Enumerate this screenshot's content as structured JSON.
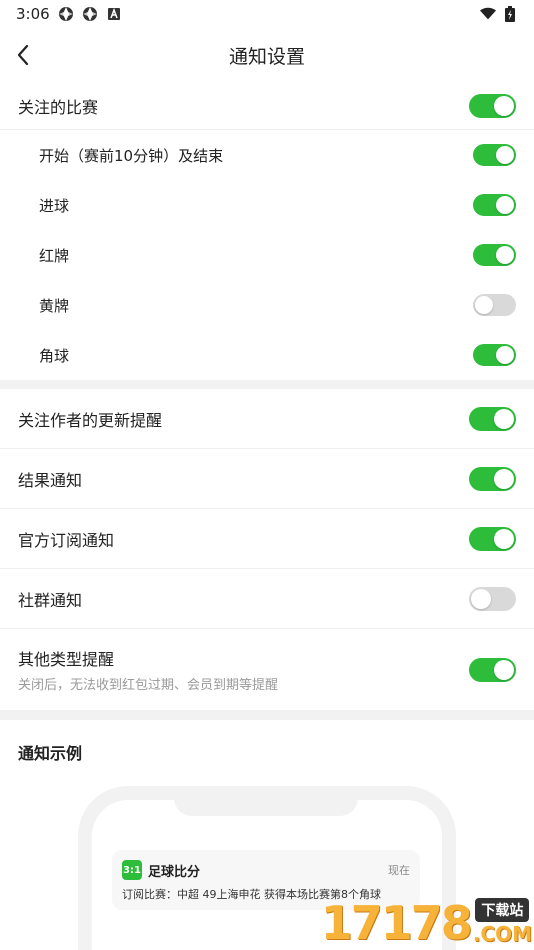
{
  "status_bar": {
    "time": "3:06",
    "left_icons": [
      "aperture-icon",
      "aperture-icon",
      "a-box-icon"
    ],
    "right_icons": [
      "wifi-icon",
      "battery-charging-icon"
    ]
  },
  "header": {
    "title": "通知设置"
  },
  "section1": {
    "main": {
      "label": "关注的比赛",
      "on": true
    },
    "items": [
      {
        "label": "开始（赛前10分钟）及结束",
        "on": true
      },
      {
        "label": "进球",
        "on": true
      },
      {
        "label": "红牌",
        "on": true
      },
      {
        "label": "黄牌",
        "on": false
      },
      {
        "label": "角球",
        "on": true
      }
    ]
  },
  "section2": {
    "items": [
      {
        "label": "关注作者的更新提醒",
        "on": true
      },
      {
        "label": "结果通知",
        "on": true
      },
      {
        "label": "官方订阅通知",
        "on": true
      },
      {
        "label": "社群通知",
        "on": false
      },
      {
        "label": "其他类型提醒",
        "desc": "关闭后，无法收到红包过期、会员到期等提醒",
        "on": true
      }
    ]
  },
  "example": {
    "title": "通知示例",
    "notification": {
      "app_logo_text": "3:1",
      "app_name": "足球比分",
      "time": "现在",
      "body": "订阅比赛：中超 49上海申花 获得本场比赛第8个角球"
    }
  },
  "watermark": {
    "number": "17178",
    "tag": "下载站",
    "suffix": ".COM"
  },
  "colors": {
    "toggle_on": "#2dbd3b",
    "toggle_off": "#d9d9d9",
    "watermark": "#f7b23a"
  }
}
